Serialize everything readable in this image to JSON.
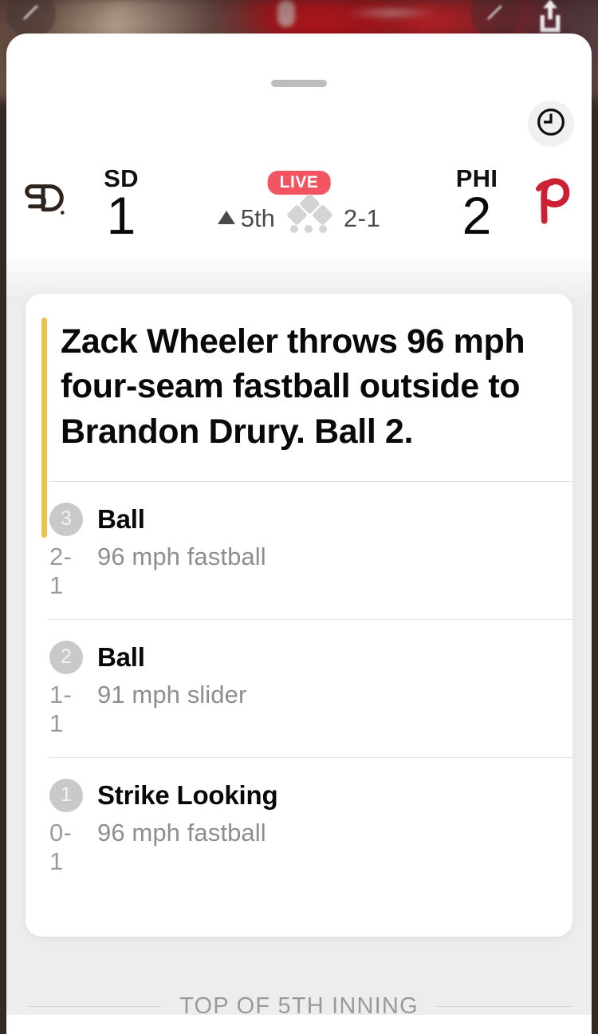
{
  "background": {
    "photo_description": "blurred red batting helmet",
    "buttons": [
      {
        "name": "edit-left",
        "icon": "pencil-icon"
      },
      {
        "name": "edit-right",
        "icon": "pencil-icon"
      },
      {
        "name": "share",
        "icon": "share-icon"
      }
    ]
  },
  "sheet": {
    "drag_handle": "grabber",
    "clock_icon": "clock-icon"
  },
  "scoreboard": {
    "away": {
      "abbr": "SD",
      "score": "1",
      "logo": "padres-logo",
      "logo_color": "#2F241D"
    },
    "home": {
      "abbr": "PHI",
      "score": "2",
      "logo": "phillies-logo",
      "logo_color": "#CC2033"
    },
    "status_badge": "LIVE",
    "status_badge_color": "#F2555F",
    "inning": "5th",
    "inning_half": "top",
    "count": "2-1",
    "bases": {
      "first": false,
      "second": false,
      "third": false
    },
    "outs": 0,
    "outs_total": 3
  },
  "play_card": {
    "accent_color": "#EAC34C",
    "headline": "Zack Wheeler throws 96 mph four-seam fastball outside to Brandon Drury. Ball 2.",
    "pitches": [
      {
        "number": "3",
        "result": "Ball",
        "count": "2-1",
        "description": "96 mph fastball"
      },
      {
        "number": "2",
        "result": "Ball",
        "count": "1-1",
        "description": "91 mph slider"
      },
      {
        "number": "1",
        "result": "Strike Looking",
        "count": "0-1",
        "description": "96 mph fastball"
      }
    ]
  },
  "footer": {
    "label": "TOP OF 5TH INNING"
  }
}
